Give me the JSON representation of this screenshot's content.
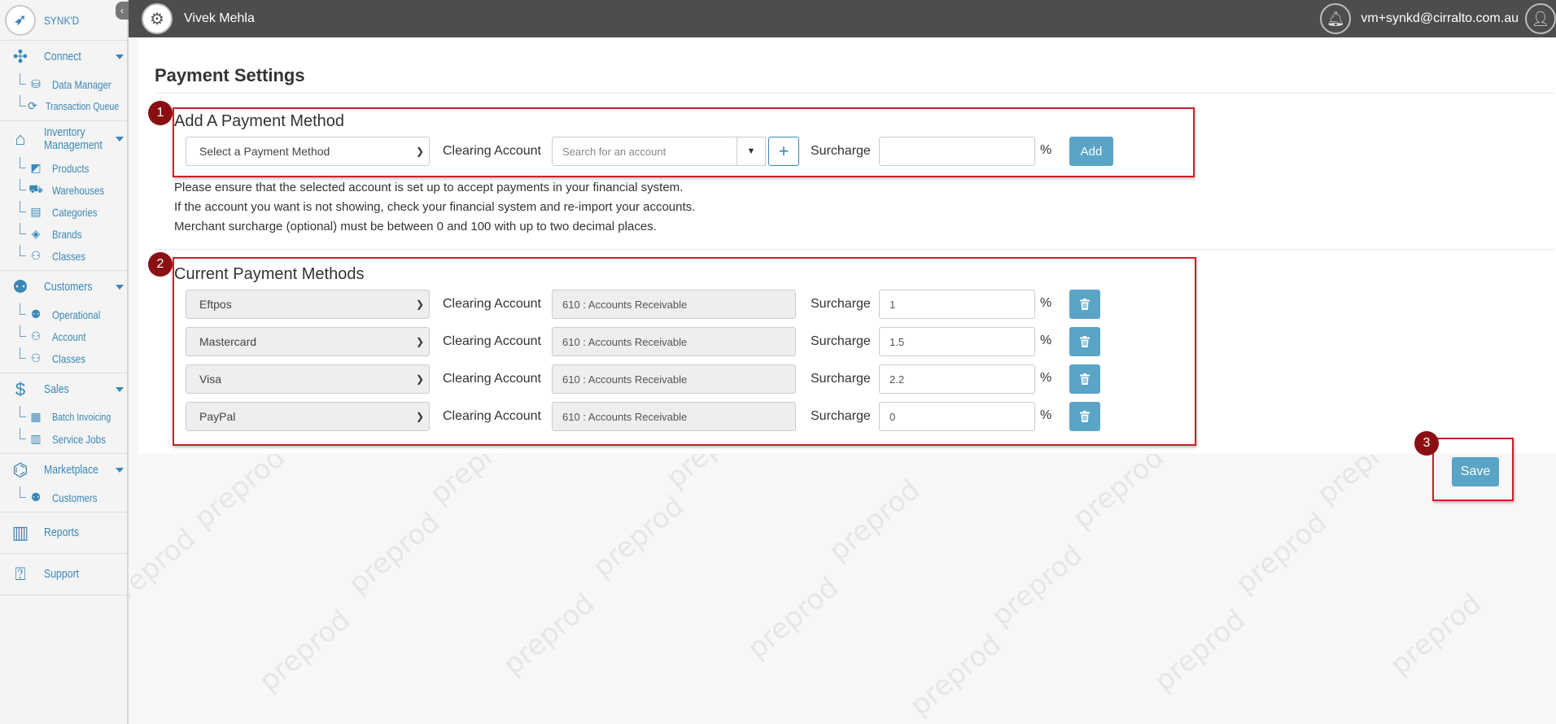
{
  "brand": {
    "name": "SYNK'D"
  },
  "topbar": {
    "user_name": "Vivek Mehla",
    "email": "vm+synkd@cirralto.com.au"
  },
  "sidebar": {
    "groups": [
      {
        "label": "Connect",
        "icon": "network-icon",
        "items": [
          {
            "label": "Data Manager",
            "icon": "database-icon"
          },
          {
            "label": "Transaction Queue",
            "icon": "sync-icon"
          }
        ]
      },
      {
        "label": "Inventory Management",
        "icon": "warehouse-icon",
        "items": [
          {
            "label": "Products",
            "icon": "box-icon"
          },
          {
            "label": "Warehouses",
            "icon": "truck-icon"
          },
          {
            "label": "Categories",
            "icon": "category-icon"
          },
          {
            "label": "Brands",
            "icon": "tag-icon"
          },
          {
            "label": "Classes",
            "icon": "hierarchy-icon"
          }
        ]
      },
      {
        "label": "Customers",
        "icon": "people-icon",
        "items": [
          {
            "label": "Operational",
            "icon": "people-icon"
          },
          {
            "label": "Account",
            "icon": "account-icon"
          },
          {
            "label": "Classes",
            "icon": "hierarchy-icon"
          }
        ]
      },
      {
        "label": "Sales",
        "icon": "sales-icon",
        "items": [
          {
            "label": "Batch Invoicing",
            "icon": "invoice-icon"
          },
          {
            "label": "Service Jobs",
            "icon": "clipboard-icon"
          }
        ]
      },
      {
        "label": "Marketplace",
        "icon": "store-icon",
        "items": [
          {
            "label": "Customers",
            "icon": "people-icon"
          }
        ]
      },
      {
        "label": "Reports",
        "icon": "chart-icon",
        "items": []
      },
      {
        "label": "Support",
        "icon": "laptop-help-icon",
        "items": []
      }
    ]
  },
  "main": {
    "title": "Payment Settings",
    "add_section": {
      "badge": "1",
      "title": "Add A Payment Method",
      "method_placeholder": "Select a Payment Method",
      "clearing_label": "Clearing Account",
      "account_placeholder": "Search for an account",
      "surcharge_label": "Surcharge",
      "surcharge_value": "",
      "percent": "%",
      "add_label": "Add"
    },
    "notes": [
      "Please ensure that the selected account is set up to accept payments in your financial system.",
      "If the account you want is not showing, check your financial system and re-import your accounts.",
      "Merchant surcharge (optional) must be between 0 and 100 with up to two decimal places."
    ],
    "current_section": {
      "badge": "2",
      "title": "Current Payment Methods",
      "methods": [
        {
          "method": "Eftpos",
          "clearing_label": "Clearing Account",
          "account": "610 : Accounts Receivable",
          "surcharge_label": "Surcharge",
          "surcharge": "1",
          "percent": "%"
        },
        {
          "method": "Mastercard",
          "clearing_label": "Clearing Account",
          "account": "610 : Accounts Receivable",
          "surcharge_label": "Surcharge",
          "surcharge": "1.5",
          "percent": "%"
        },
        {
          "method": "Visa",
          "clearing_label": "Clearing Account",
          "account": "610 : Accounts Receivable",
          "surcharge_label": "Surcharge",
          "surcharge": "2.2",
          "percent": "%"
        },
        {
          "method": "PayPal",
          "clearing_label": "Clearing Account",
          "account": "610 : Accounts Receivable",
          "surcharge_label": "Surcharge",
          "surcharge": "0",
          "percent": "%"
        }
      ]
    },
    "save": {
      "badge": "3",
      "label": "Save"
    }
  },
  "watermark": {
    "text": "preprod"
  }
}
